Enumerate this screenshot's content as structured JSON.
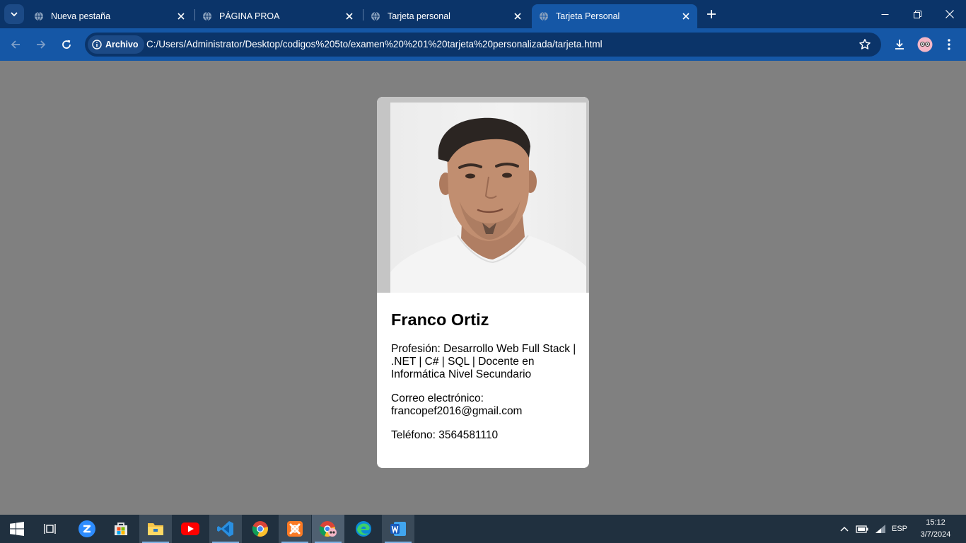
{
  "browser": {
    "tabs": [
      {
        "label": "Nueva pestaña",
        "active": false
      },
      {
        "label": "PÁGINA PROA",
        "active": false
      },
      {
        "label": "Tarjeta personal",
        "active": false
      },
      {
        "label": "Tarjeta Personal",
        "active": true
      }
    ],
    "site_chip": "Archivo",
    "url": "C:/Users/Administrator/Desktop/codigos%205to/examen%20%201%20tarjeta%20personalizada/tarjeta.html",
    "colors": {
      "frame": "#0b3469",
      "toolbar": "#1557a6"
    }
  },
  "card": {
    "name": "Franco Ortiz",
    "profession": "Profesión: Desarrollo Web Full Stack | .NET | C# | SQL | Docente en Informática Nivel Secundario",
    "email": "Correo electrónico: francopef2016@gmail.com",
    "phone": "Teléfono: 3564581110"
  },
  "page": {
    "background": "#808080"
  },
  "taskbar": {
    "apps": [
      "windows-start",
      "task-view",
      "zoom",
      "microsoft-store",
      "file-explorer",
      "youtube",
      "visual-studio-code",
      "google-chrome",
      "xampp",
      "chrome-profile",
      "microsoft-edge",
      "microsoft-word"
    ],
    "language": "ESP",
    "time": "15:12",
    "date": "3/7/2024"
  }
}
